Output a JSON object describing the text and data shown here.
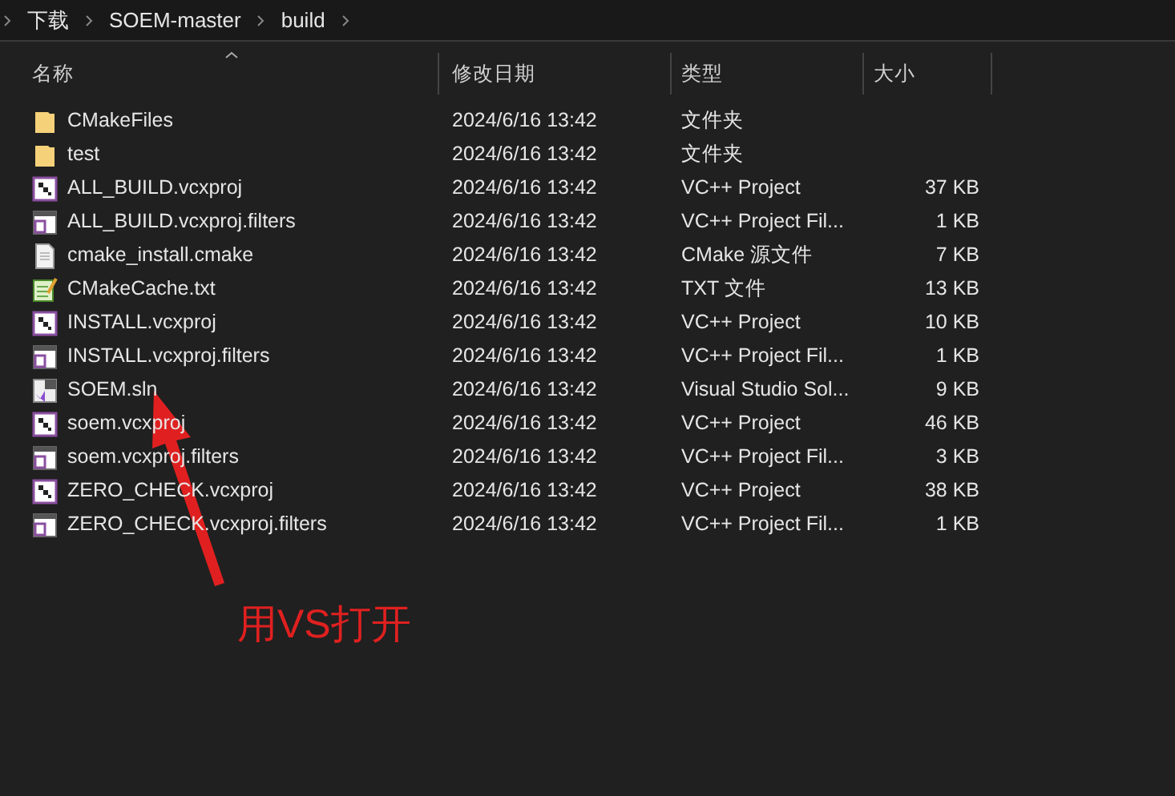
{
  "breadcrumb": [
    "下载",
    "SOEM-master",
    "build"
  ],
  "columns": [
    "名称",
    "修改日期",
    "类型",
    "大小"
  ],
  "rows": [
    {
      "kind": "folder",
      "name": "CMakeFiles",
      "date": "2024/6/16 13:42",
      "type": "文件夹"
    },
    {
      "kind": "folder",
      "name": "test",
      "date": "2024/6/16 13:42",
      "type": "文件夹"
    },
    {
      "kind": "project",
      "name": "ALL_BUILD.vcxproj",
      "date": "2024/6/16 13:42",
      "type": "VC++ Project",
      "size": "37 KB"
    },
    {
      "kind": "filters",
      "name": "ALL_BUILD.vcxproj.filters",
      "date": "2024/6/16 13:42",
      "type": "VC++ Project Fil...",
      "size": "1 KB"
    },
    {
      "kind": "file",
      "name": "cmake_install.cmake",
      "date": "2024/6/16 13:42",
      "type": "CMake 源文件",
      "size": "7 KB"
    },
    {
      "kind": "text",
      "name": "CMakeCache.txt",
      "date": "2024/6/16 13:42",
      "type": "TXT 文件",
      "size": "13 KB"
    },
    {
      "kind": "project",
      "name": "INSTALL.vcxproj",
      "date": "2024/6/16 13:42",
      "type": "VC++ Project",
      "size": "10 KB"
    },
    {
      "kind": "filters",
      "name": "INSTALL.vcxproj.filters",
      "date": "2024/6/16 13:42",
      "type": "VC++ Project Fil...",
      "size": "1 KB"
    },
    {
      "kind": "solution",
      "name": "SOEM.sln",
      "date": "2024/6/16 13:42",
      "type": "Visual Studio Sol...",
      "size": "9 KB"
    },
    {
      "kind": "project",
      "name": "soem.vcxproj",
      "date": "2024/6/16 13:42",
      "type": "VC++ Project",
      "size": "46 KB"
    },
    {
      "kind": "filters",
      "name": "soem.vcxproj.filters",
      "date": "2024/6/16 13:42",
      "type": "VC++ Project Fil...",
      "size": "3 KB"
    },
    {
      "kind": "project",
      "name": "ZERO_CHECK.vcxproj",
      "date": "2024/6/16 13:42",
      "type": "VC++ Project",
      "size": "38 KB"
    },
    {
      "kind": "filters",
      "name": "ZERO_CHECK.vcxproj.filters",
      "date": "2024/6/16 13:42",
      "type": "VC++ Project Fil...",
      "size": "1 KB"
    }
  ],
  "annotation": {
    "text": "用VS打开"
  }
}
